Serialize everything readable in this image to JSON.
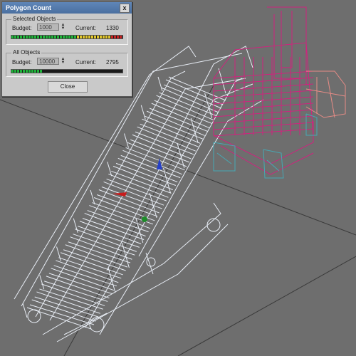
{
  "dialog": {
    "title": "Polygon Count",
    "close_glyph": "x",
    "close_button_label": "Close",
    "selected": {
      "group_label": "Selected Objects",
      "budget_label": "Budget:",
      "budget_value": "1000",
      "current_label": "Current:",
      "current_value": "1330",
      "meter_fraction": 1.0,
      "meter_over": true
    },
    "all": {
      "group_label": "All Objects",
      "budget_label": "Budget:",
      "budget_value": "10000",
      "current_label": "Current:",
      "current_value": "2795",
      "meter_fraction": 0.28,
      "meter_over": false
    }
  },
  "spinner_glyphs": {
    "up": "▲",
    "down": "▼"
  },
  "colors": {
    "viewport_bg": "#6e6e6e",
    "wire_main": "#e9eef6",
    "wire_magenta": "#d0237e",
    "wire_salmon": "#e88c86",
    "wire_cyan": "#46a8b4",
    "meter_ok": "#1fb53a",
    "meter_warn": "#e0c62c",
    "meter_over": "#c62222"
  },
  "viewport_icons": [
    "axis-gizmo-red-icon",
    "axis-gizmo-blue-icon",
    "axis-gizmo-green-icon"
  ]
}
